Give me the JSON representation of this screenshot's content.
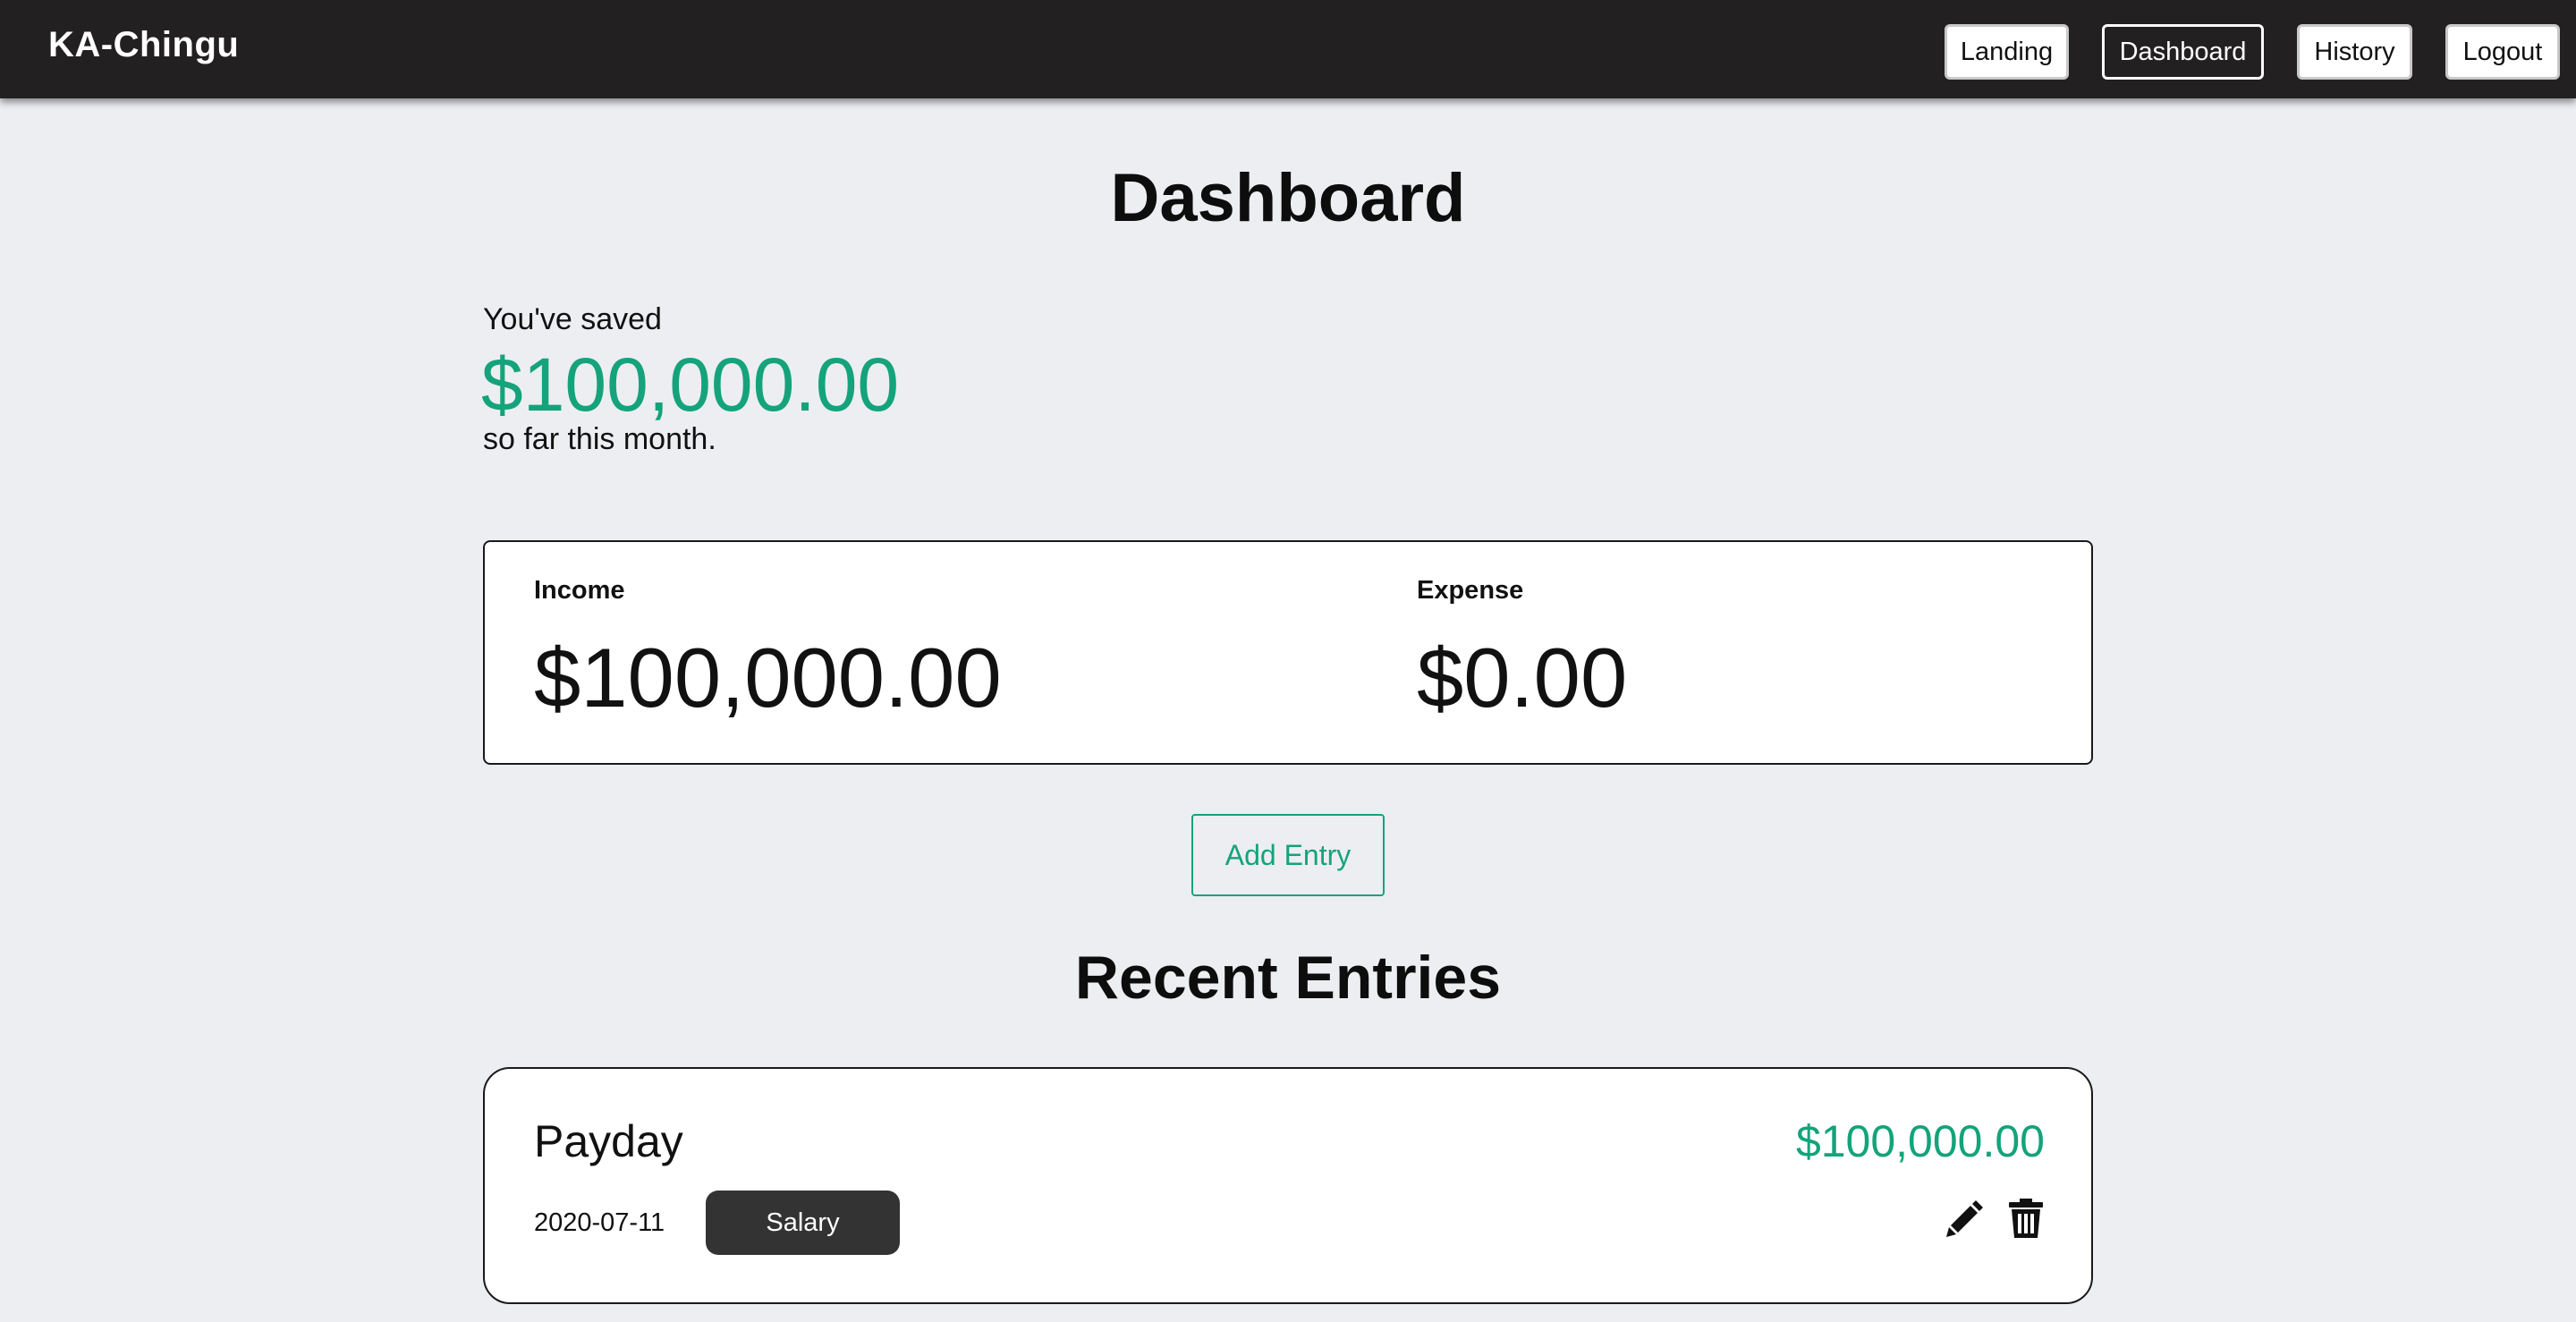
{
  "app": {
    "brand": "KA-Chingu"
  },
  "nav": {
    "items": [
      {
        "label": "Landing",
        "active": false
      },
      {
        "label": "Dashboard",
        "active": true
      },
      {
        "label": "History",
        "active": false
      },
      {
        "label": "Logout",
        "active": false
      }
    ]
  },
  "page": {
    "title": "Dashboard"
  },
  "savings": {
    "prefix": "You've saved",
    "amount": "$100,000.00",
    "suffix": "so far this month."
  },
  "summary": {
    "income_label": "Income",
    "income_value": "$100,000.00",
    "expense_label": "Expense",
    "expense_value": "$0.00"
  },
  "actions": {
    "add_entry_label": "Add Entry"
  },
  "recent": {
    "title": "Recent Entries",
    "entries": [
      {
        "title": "Payday",
        "amount": "$100,000.00",
        "date": "2020-07-11",
        "category": "Salary",
        "edit_icon": "pencil-icon",
        "delete_icon": "trash-icon"
      }
    ]
  },
  "colors": {
    "navbar_bg": "#232021",
    "page_bg": "#eceef2",
    "accent_green": "#14a37a",
    "tag_bg": "#333333"
  }
}
